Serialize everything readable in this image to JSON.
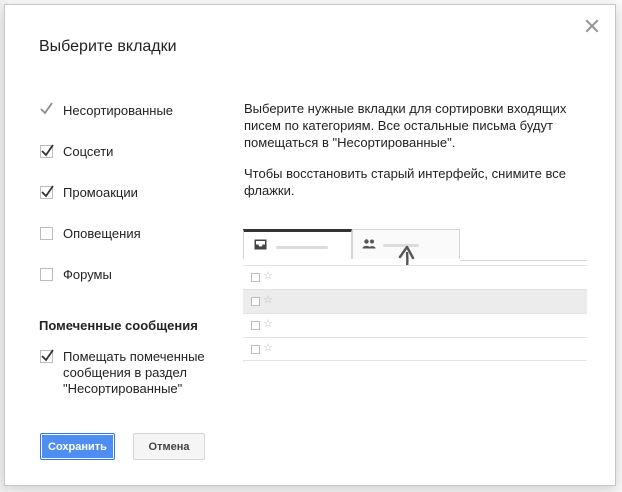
{
  "dialog": {
    "title": "Выберите вкладки",
    "close_icon": "close-icon"
  },
  "options": [
    {
      "label": "Несортированные",
      "checked": true,
      "locked": true
    },
    {
      "label": "Соцсети",
      "checked": true,
      "locked": false
    },
    {
      "label": "Промоакции",
      "checked": true,
      "locked": false
    },
    {
      "label": "Оповещения",
      "checked": false,
      "locked": false
    },
    {
      "label": "Форумы",
      "checked": false,
      "locked": false
    }
  ],
  "starred": {
    "section_title": "Помеченные сообщения",
    "label": "Помещать помеченные сообщения в раздел \"Несортированные\"",
    "checked": true
  },
  "description": {
    "paragraph1": "Выберите нужные вкладки для сортировки входящих писем по категориям. Все остальные письма будут помещаться в \"Несортированные\".",
    "paragraph2": "Чтобы восстановить старый интерфейс, снимите все флажки."
  },
  "preview": {
    "tab_icons": [
      "inbox-icon",
      "people-icon"
    ],
    "row_icons": [
      "checkbox-icon",
      "star-icon"
    ]
  },
  "buttons": {
    "save_label": "Сохранить",
    "cancel_label": "Отмена"
  },
  "colors": {
    "primary": "#4d8ef0",
    "check": "#333333"
  }
}
